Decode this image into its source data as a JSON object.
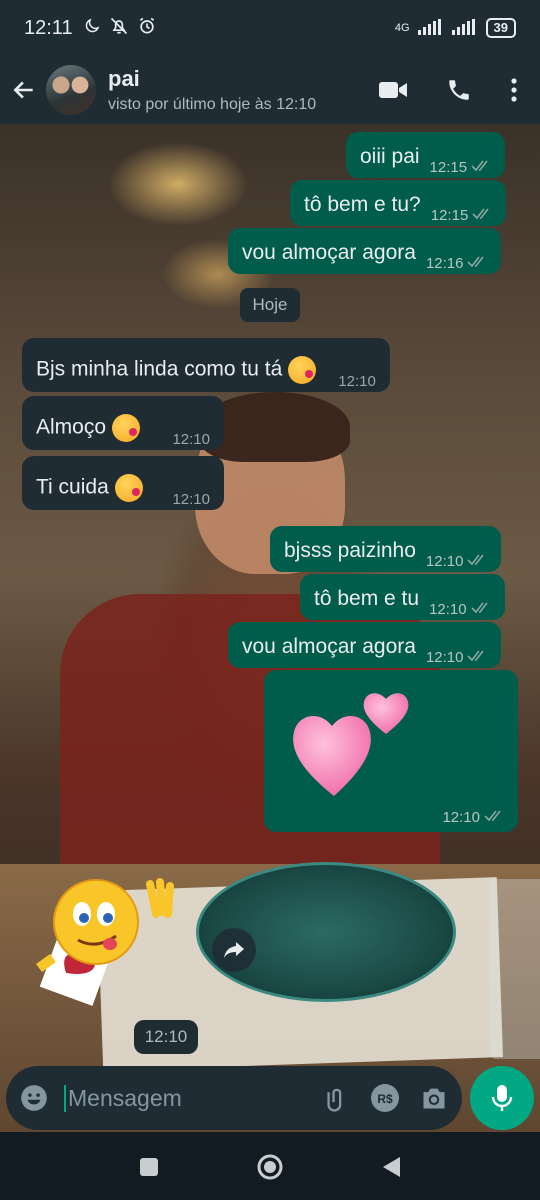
{
  "status_bar": {
    "time": "12:11",
    "network": "4G",
    "battery": "39"
  },
  "header": {
    "contact_name": "pai",
    "last_seen": "visto por último hoje às 12:10"
  },
  "messages": [
    {
      "dir": "out",
      "text": "oiii pai",
      "time": "12:15"
    },
    {
      "dir": "out",
      "text": "tô bem e tu?",
      "time": "12:15"
    },
    {
      "dir": "out",
      "text": "vou almoçar agora",
      "time": "12:16"
    },
    {
      "dir": "in",
      "text": "Bjs minha linda como tu tá",
      "time": "12:10",
      "emoji": "kissing-face"
    },
    {
      "dir": "in",
      "text": "Almoço",
      "time": "12:10",
      "emoji": "kissing-face"
    },
    {
      "dir": "in",
      "text": "Ti cuida",
      "time": "12:10",
      "emoji": "kissing-face"
    },
    {
      "dir": "out",
      "text": "bjsss paizinho",
      "time": "12:10"
    },
    {
      "dir": "out",
      "text": "tô bem e tu",
      "time": "12:10"
    },
    {
      "dir": "out",
      "text": "vou almoçar agora",
      "time": "12:10"
    }
  ],
  "date_chip": "Hoje",
  "sticker_hearts": {
    "time": "12:10"
  },
  "sticker_emoji": {
    "time": "12:10"
  },
  "input": {
    "placeholder": "Mensagem"
  },
  "colors": {
    "outgoing": "#005c4b",
    "incoming": "#1f2c34",
    "accent": "#00a884",
    "header": "#1f2c34"
  }
}
